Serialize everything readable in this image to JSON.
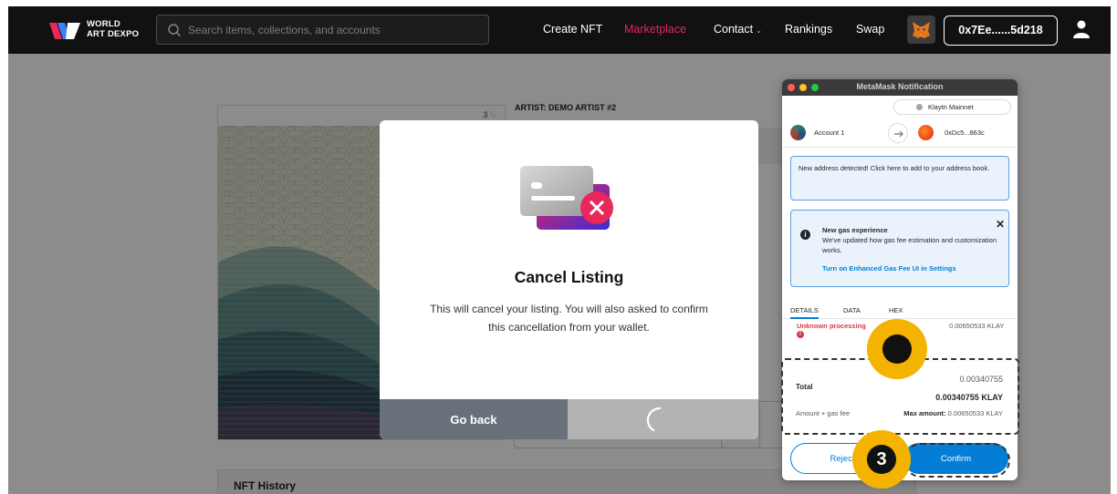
{
  "header": {
    "logo_line1": "WORLD",
    "logo_line2": "ART DEXPO",
    "search_placeholder": "Search items, collections, and accounts",
    "nav": {
      "create_nft": "Create NFT",
      "marketplace": "Marketplace",
      "contact": "Contact",
      "rankings": "Rankings",
      "swap": "Swap"
    },
    "wallet_address": "0x7Ee......5d218",
    "active_color": "#e8275a"
  },
  "page": {
    "likes": "3",
    "artist": "ARTIST: DEMO ARTIST #2",
    "history_title": "NFT History"
  },
  "modal": {
    "title": "Cancel Listing",
    "message": "This will cancel your listing. You will also asked to confirm this cancellation from your wallet.",
    "go_back": "Go back"
  },
  "metamask": {
    "window_title": "MetaMask Notification",
    "network": "Klaytn Mainnet",
    "account_name": "Account 1",
    "dest_address": "0xDc5...863c",
    "new_address_notice": "New address detected! Click here to add to your address book.",
    "gas_title": "New gas experience",
    "gas_body": "We've updated how gas fee estimation and customization works.",
    "gas_link": "Turn on Enhanced Gas Fee UI in Settings",
    "tabs": [
      "DETAILS",
      "DATA",
      "HEX"
    ],
    "unknown_processing": "Unknown processing",
    "processing_value": "0.00650533 KLAY",
    "total_label": "Total",
    "total_value": "0.00340755",
    "total_value_klay": "0.00340755 KLAY",
    "amount_gas_label": "Amount + gas fee",
    "max_amount_label": "Max amount:",
    "max_amount_value": "0.00650533 KLAY",
    "reject": "Reject",
    "confirm": "Confirm",
    "accent_color": "#037dd6"
  },
  "annotation": {
    "step_number": "3",
    "highlight_color": "#f3b300"
  }
}
